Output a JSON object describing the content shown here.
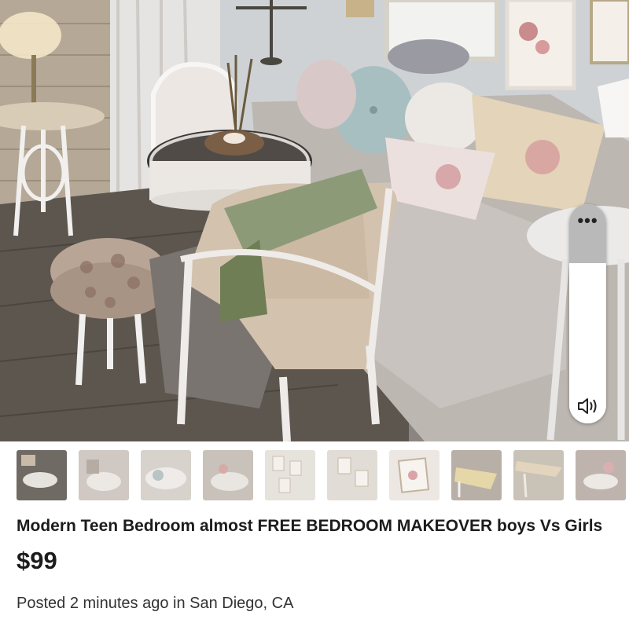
{
  "photo": {
    "alt_icon": "listing-photo"
  },
  "volume": {
    "menu_glyph": "•••",
    "level": 0.73,
    "icon": "speaker-icon"
  },
  "thumbnails": [
    {
      "tone": "#7a756c"
    },
    {
      "tone": "#cfc8c3"
    },
    {
      "tone": "#d8d2cc"
    },
    {
      "tone": "#c9c2ba"
    },
    {
      "tone": "#e6e2dc"
    },
    {
      "tone": "#e1dcd5"
    },
    {
      "tone": "#ece7e2"
    },
    {
      "tone": "#b8b0a6"
    },
    {
      "tone": "#c9c2b7"
    },
    {
      "tone": "#bfb3ad"
    },
    {
      "tone": "#dcd8d4"
    }
  ],
  "listing": {
    "title": "Modern Teen Bedroom  almost FREE BEDROOM MAKEOVER boys Vs Girls",
    "price": "$99",
    "posted_prefix": "Posted ",
    "posted_time": "2 minutes ago",
    "posted_mid": " in ",
    "location": "San Diego, CA"
  }
}
